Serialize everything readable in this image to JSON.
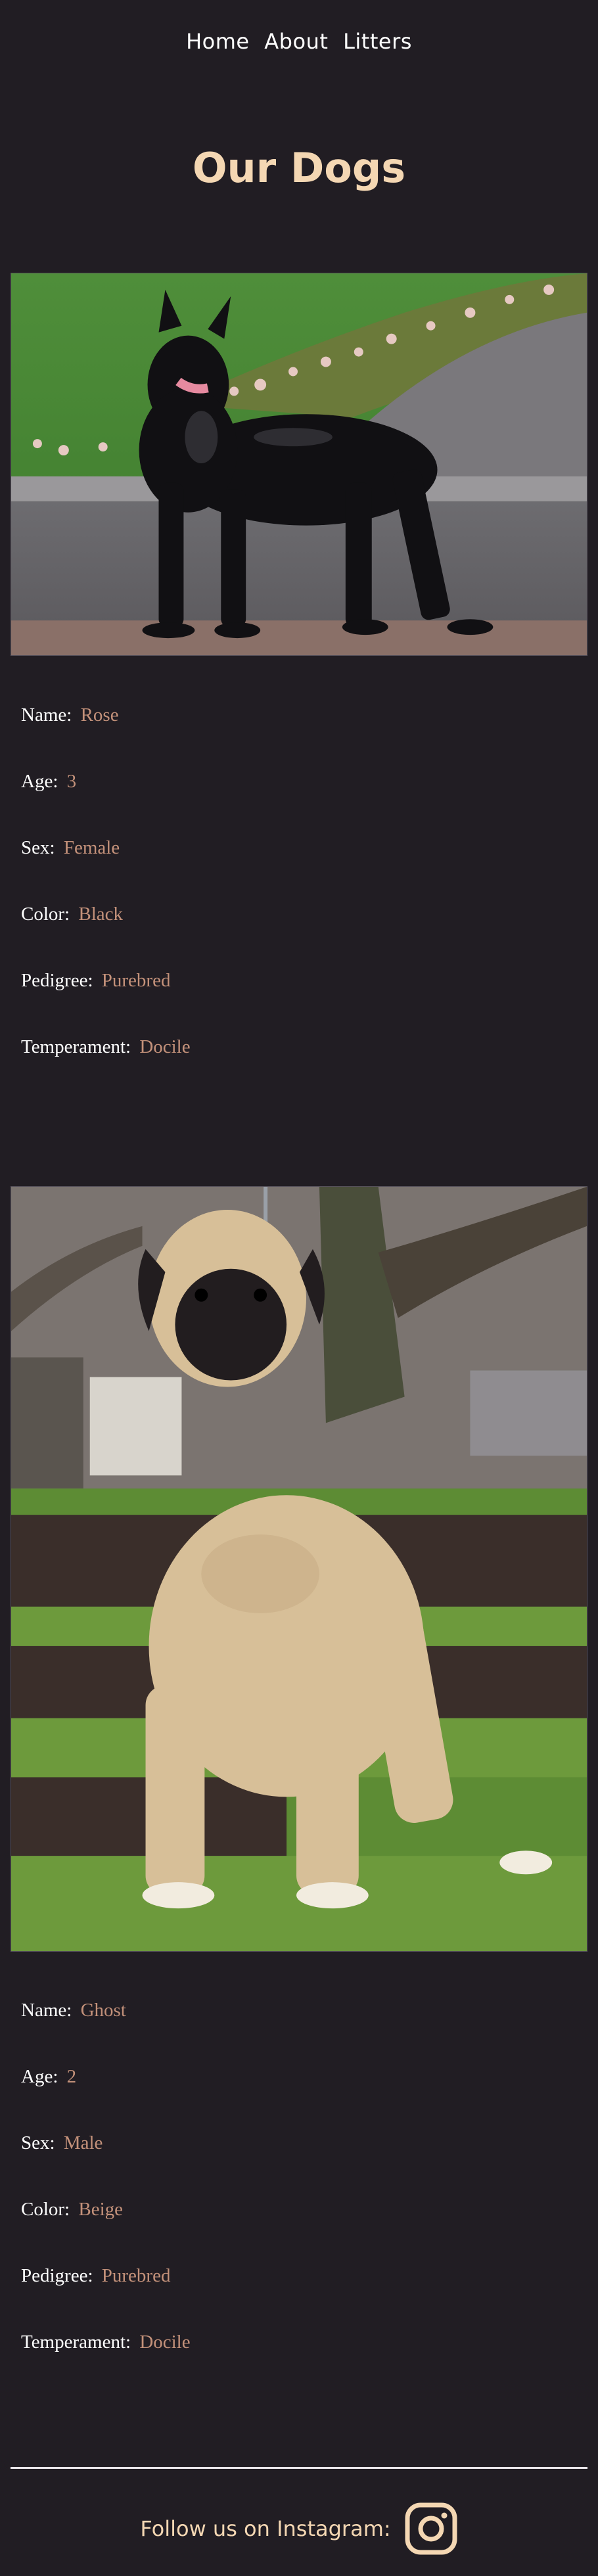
{
  "nav": {
    "items": [
      "Home",
      "About",
      "Litters"
    ]
  },
  "page": {
    "title": "Our Dogs"
  },
  "dogs": [
    {
      "fields": [
        {
          "label": "Name:",
          "value": "Rose"
        },
        {
          "label": "Age:",
          "value": "3"
        },
        {
          "label": "Sex:",
          "value": "Female"
        },
        {
          "label": "Color:",
          "value": "Black"
        },
        {
          "label": "Pedigree:",
          "value": "Purebred"
        },
        {
          "label": "Temperament:",
          "value": "Docile"
        }
      ]
    },
    {
      "fields": [
        {
          "label": "Name:",
          "value": "Ghost"
        },
        {
          "label": "Age:",
          "value": "2"
        },
        {
          "label": "Sex:",
          "value": "Male"
        },
        {
          "label": "Color:",
          "value": "Beige"
        },
        {
          "label": "Pedigree:",
          "value": "Purebred"
        },
        {
          "label": "Temperament:",
          "value": "Docile"
        }
      ]
    }
  ],
  "footer": {
    "text": "Follow us on Instagram:",
    "icon": "instagram-icon"
  },
  "colors": {
    "background": "#211d23",
    "accent": "#f4d7b3",
    "value_text": "#c3917a"
  }
}
